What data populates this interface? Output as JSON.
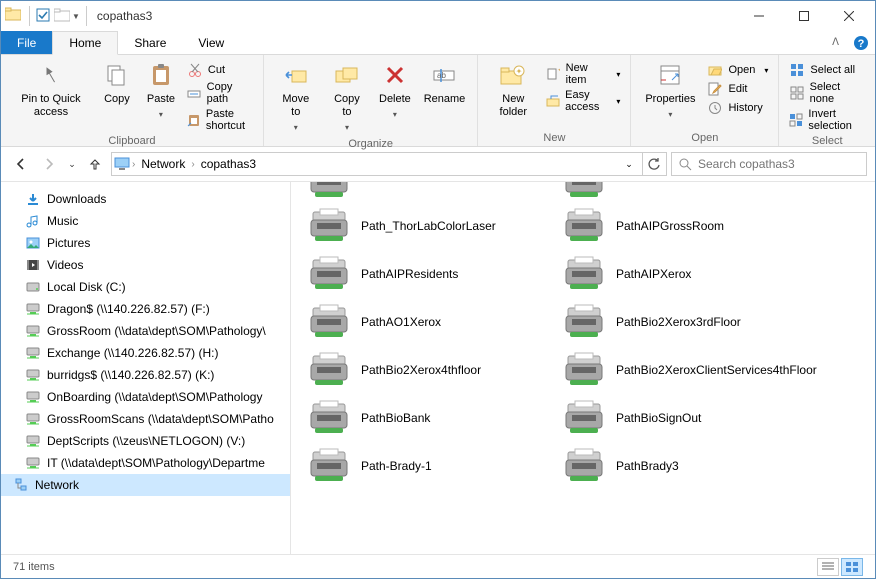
{
  "title": "copathas3",
  "ribbon": {
    "tabs": {
      "file": "File",
      "home": "Home",
      "share": "Share",
      "view": "View"
    },
    "clipboard": {
      "group": "Clipboard",
      "pin": "Pin to Quick access",
      "copy": "Copy",
      "paste": "Paste",
      "cut": "Cut",
      "copy_path": "Copy path",
      "paste_shortcut": "Paste shortcut"
    },
    "organize": {
      "group": "Organize",
      "move_to": "Move to",
      "copy_to": "Copy to",
      "delete": "Delete",
      "rename": "Rename"
    },
    "new": {
      "group": "New",
      "new_folder": "New folder",
      "new_item": "New item",
      "easy_access": "Easy access"
    },
    "open": {
      "group": "Open",
      "properties": "Properties",
      "open": "Open",
      "edit": "Edit",
      "history": "History"
    },
    "select": {
      "group": "Select",
      "select_all": "Select all",
      "select_none": "Select none",
      "invert": "Invert selection"
    }
  },
  "breadcrumb": {
    "network": "Network",
    "location": "copathas3"
  },
  "search": {
    "placeholder": "Search copathas3"
  },
  "tree": [
    {
      "name": "Downloads",
      "icon": "download"
    },
    {
      "name": "Music",
      "icon": "music"
    },
    {
      "name": "Pictures",
      "icon": "pictures"
    },
    {
      "name": "Videos",
      "icon": "videos"
    },
    {
      "name": "Local Disk (C:)",
      "icon": "disk"
    },
    {
      "name": "Dragon$ (\\\\140.226.82.57) (F:)",
      "icon": "netdrive"
    },
    {
      "name": "GrossRoom (\\\\data\\dept\\SOM\\Pathology\\",
      "icon": "netdrive"
    },
    {
      "name": "Exchange (\\\\140.226.82.57) (H:)",
      "icon": "netdrive"
    },
    {
      "name": "burridgs$ (\\\\140.226.82.57) (K:)",
      "icon": "netdrive"
    },
    {
      "name": "OnBoarding (\\\\data\\dept\\SOM\\Pathology",
      "icon": "netdrive"
    },
    {
      "name": "GrossRoomScans (\\\\data\\dept\\SOM\\Patho",
      "icon": "netdrive"
    },
    {
      "name": "DeptScripts (\\\\zeus\\NETLOGON) (V:)",
      "icon": "netdrive"
    },
    {
      "name": "IT (\\\\data\\dept\\SOM\\Pathology\\Departme",
      "icon": "netdrive"
    },
    {
      "name": "Network",
      "icon": "network",
      "selected": true
    }
  ],
  "items": [
    {
      "name": "",
      "partial": true
    },
    {
      "name": "",
      "partial": true
    },
    {
      "name": "Path_ThorLabColorLaser"
    },
    {
      "name": "PathAIPGrossRoom"
    },
    {
      "name": "PathAIPResidents"
    },
    {
      "name": "PathAIPXerox"
    },
    {
      "name": "PathAO1Xerox"
    },
    {
      "name": "PathBio2Xerox3rdFloor"
    },
    {
      "name": "PathBio2Xerox4thfloor"
    },
    {
      "name": "PathBio2XeroxClientServices4thFloor"
    },
    {
      "name": "PathBioBank"
    },
    {
      "name": "PathBioSignOut"
    },
    {
      "name": "Path-Brady-1"
    },
    {
      "name": "PathBrady3"
    }
  ],
  "status": {
    "count": "71 items"
  }
}
